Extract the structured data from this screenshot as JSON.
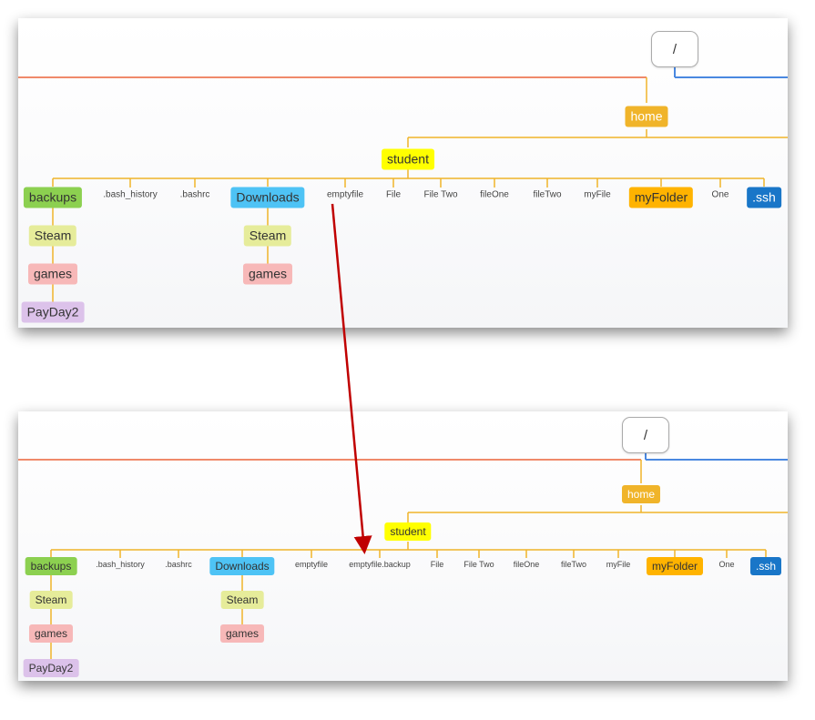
{
  "top_tree": {
    "root": "/",
    "home": "home",
    "student": "student",
    "backups": "backups",
    "backups_steam": "Steam",
    "backups_games": "games",
    "payday": "PayDay2",
    "bash_history": ".bash_history",
    "bashrc": ".bashrc",
    "downloads": "Downloads",
    "downloads_steam": "Steam",
    "downloads_games": "games",
    "emptyfile": "emptyfile",
    "file": "File",
    "file_two": "File Two",
    "file_one_lower": "fileOne",
    "file_two_lower": "fileTwo",
    "my_file": "myFile",
    "my_folder": "myFolder",
    "one": "One",
    "ssh": ".ssh"
  },
  "bottom_tree": {
    "root": "/",
    "home": "home",
    "student": "student",
    "backups": "backups",
    "backups_steam": "Steam",
    "backups_games": "games",
    "payday": "PayDay2",
    "bash_history": ".bash_history",
    "bashrc": ".bashrc",
    "downloads": "Downloads",
    "downloads_steam": "Steam",
    "downloads_games": "games",
    "emptyfile": "emptyfile",
    "emptyfile_backup": "emptyfile.backup",
    "file": "File",
    "file_two": "File Two",
    "file_one_lower": "fileOne",
    "file_two_lower": "fileTwo",
    "my_file": "myFile",
    "my_folder": "myFolder",
    "one": "One",
    "ssh": ".ssh"
  },
  "colors": {
    "root_border": "#aaaaaa",
    "home": "#f0b42a",
    "student": "#ffff00",
    "backups": "#8cd050",
    "downloads": "#4ec3f5",
    "steam": "#e6ec9a",
    "games": "#f7b8b8",
    "payday": "#dcc2ea",
    "my_folder": "#ffb300",
    "ssh": "#1976c8",
    "connector": "#f0b42a",
    "left_rule": "#f08a6a",
    "right_rule": "#4a88e0",
    "arrow": "#c00000"
  }
}
